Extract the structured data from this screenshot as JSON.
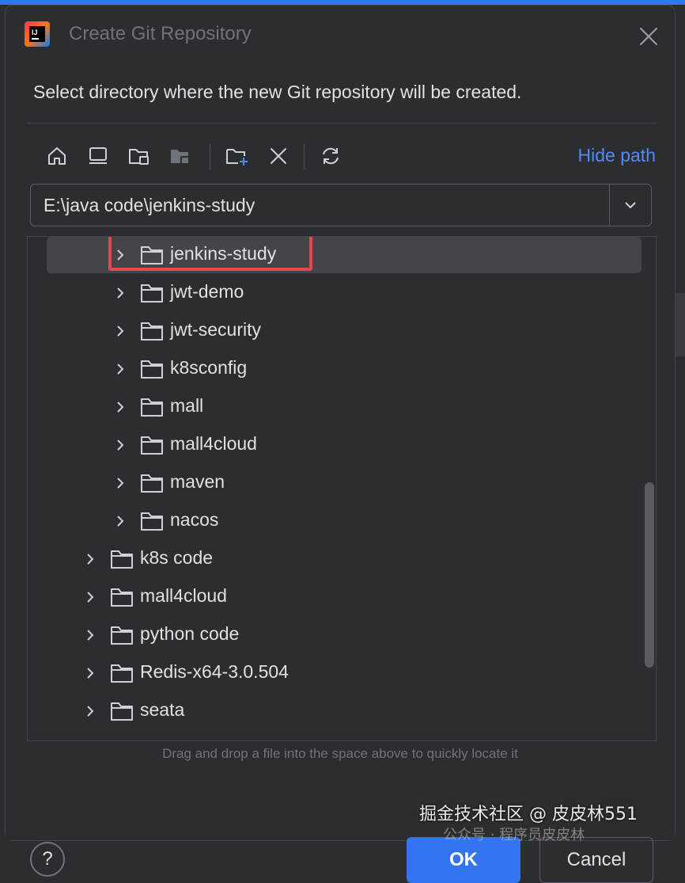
{
  "window": {
    "title": "Create Git Repository",
    "app_icon": "intellij-idea-icon"
  },
  "instruction": "Select directory where the new Git repository will be created.",
  "toolbar": {
    "buttons": [
      {
        "name": "home-icon"
      },
      {
        "name": "desktop-icon"
      },
      {
        "name": "project-folder-icon"
      },
      {
        "name": "module-folder-icon"
      },
      {
        "name": "new-folder-icon"
      },
      {
        "name": "delete-icon"
      },
      {
        "name": "refresh-icon"
      }
    ],
    "hide_path_label": "Hide path"
  },
  "path": {
    "value": "E:\\java code\\jenkins-study"
  },
  "tree": {
    "rows": [
      {
        "label": "jenkins-study",
        "level": 2,
        "selected": true,
        "highlighted": true
      },
      {
        "label": "jwt-demo",
        "level": 2
      },
      {
        "label": "jwt-security",
        "level": 2
      },
      {
        "label": "k8sconfig",
        "level": 2
      },
      {
        "label": "mall",
        "level": 2
      },
      {
        "label": "mall4cloud",
        "level": 2
      },
      {
        "label": "maven",
        "level": 2
      },
      {
        "label": "nacos",
        "level": 2
      },
      {
        "label": "k8s code",
        "level": 1
      },
      {
        "label": "mall4cloud",
        "level": 1
      },
      {
        "label": "python code",
        "level": 1
      },
      {
        "label": "Redis-x64-3.0.504",
        "level": 1
      },
      {
        "label": "seata",
        "level": 1
      }
    ]
  },
  "hint": "Drag and drop a file into the space above to quickly locate it",
  "buttons": {
    "help": "?",
    "ok": "OK",
    "cancel": "Cancel"
  },
  "watermark": {
    "main": "掘金技术社区 @ 皮皮林551",
    "sub": "公众号 · 程序员皮皮林"
  },
  "colors": {
    "accent": "#3574f0",
    "link": "#548af7",
    "highlight_box": "#e0494f",
    "background": "#2b2d30",
    "selection": "#43454a"
  }
}
